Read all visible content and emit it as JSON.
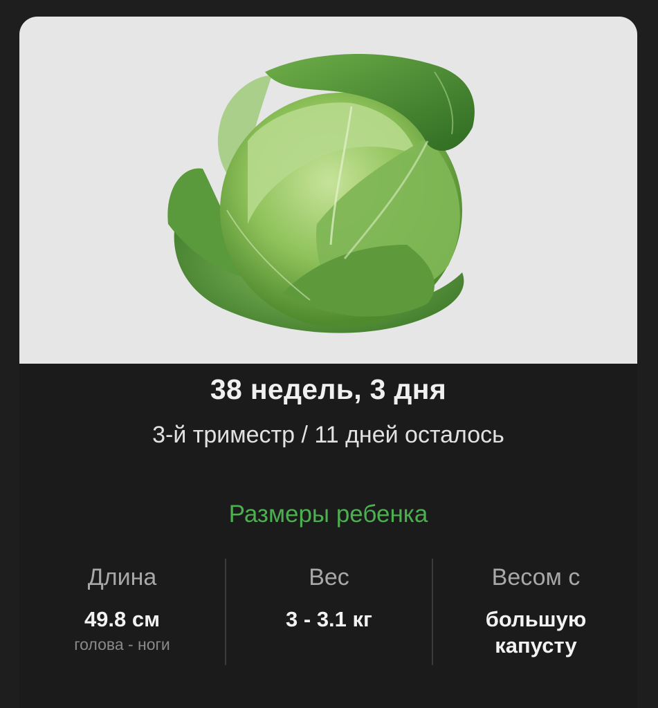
{
  "hero": {
    "image_icon": "cabbage-illustration",
    "background_color": "#e6e6e6"
  },
  "header": {
    "title": "38 недель, 3 дня",
    "subtitle": "3-й триместр / 11 дней осталось"
  },
  "baby_size": {
    "section_title": "Размеры ребенка",
    "accent_color": "#4caf50",
    "stats": [
      {
        "label": "Длина",
        "value": "49.8 см",
        "note": "голова - ноги"
      },
      {
        "label": "Вес",
        "value": "3 - 3.1 кг",
        "note": ""
      },
      {
        "label": "Весом с",
        "value_line1": "большую",
        "value_line2": "капусту"
      }
    ]
  }
}
